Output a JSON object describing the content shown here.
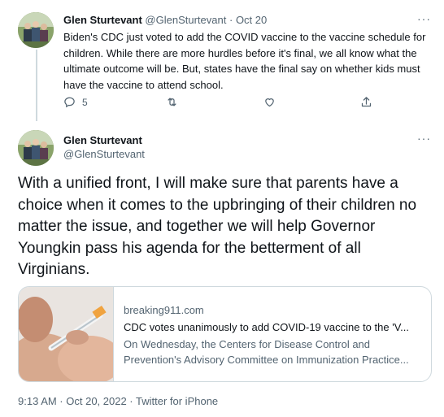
{
  "reply_tweet": {
    "author_name": "Glen Sturtevant",
    "author_handle": "@GlenSturtevant",
    "separator": "·",
    "date": "Oct 20",
    "more": "···",
    "text": "Biden's CDC just voted to add the COVID vaccine to the vaccine schedule for children. While there are more hurdles before it's final, we all know what the ultimate outcome will be. But, states have the final say on whether kids must have the vaccine to attend school.",
    "actions": {
      "reply_icon": "reply-icon",
      "reply_count": "5",
      "retweet_icon": "retweet-icon",
      "like_icon": "heart-icon",
      "share_icon": "share-icon"
    }
  },
  "main_tweet": {
    "author_name": "Glen Sturtevant",
    "author_handle": "@GlenSturtevant",
    "more": "···",
    "text": "With a unified front, I will make sure that parents have a choice when it comes to the upbringing of their children no matter the issue, and together we will help Governor Youngkin pass his agenda for the betterment of all Virginians.",
    "card": {
      "domain": "breaking911.com",
      "title": "CDC votes unanimously to add COVID-19 vaccine to the 'V...",
      "description": "On Wednesday, the Centers for Disease Control and Prevention's Advisory Committee on Immunization Practice..."
    },
    "timestamp": "9:13 AM · Oct 20, 2022 · Twitter for iPhone"
  },
  "colors": {
    "text": "#0f1419",
    "muted": "#536471",
    "border": "#cfd9de"
  }
}
